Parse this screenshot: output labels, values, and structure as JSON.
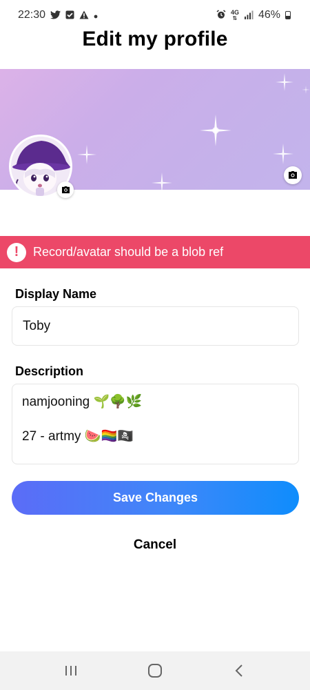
{
  "status_bar": {
    "time": "22:30",
    "battery": "46%",
    "left_icons": [
      "twitter-icon",
      "check-box-icon",
      "warning-icon",
      "dot-icon"
    ],
    "right_icons": [
      "alarm-icon",
      "4g-icon",
      "signal-icon",
      "battery-icon"
    ],
    "network_label": "4G"
  },
  "header": {
    "title": "Edit my profile"
  },
  "banner": {
    "icons": [
      "sparkle-icon",
      "camera-icon"
    ],
    "colors": {
      "start": "#dcb2e8",
      "end": "#c3b4ec"
    }
  },
  "avatar": {
    "icons": [
      "camera-icon"
    ]
  },
  "error": {
    "icon": "!",
    "message": "Record/avatar should be a blob ref",
    "color": "#ec4868"
  },
  "form": {
    "display_name_label": "Display Name",
    "display_name_value": "Toby",
    "description_label": "Description",
    "description_line_1": "namjooning 🌱🌳🌿",
    "description_line_2": "27 - artmy 🍉🏳️‍🌈🏴‍☠️"
  },
  "actions": {
    "save_label": "Save Changes",
    "cancel_label": "Cancel",
    "save_gradient": [
      "#5b6cf7",
      "#0f8dfc"
    ]
  },
  "nav_bar": {
    "icons": [
      "recent-apps-icon",
      "home-icon",
      "back-icon"
    ]
  }
}
